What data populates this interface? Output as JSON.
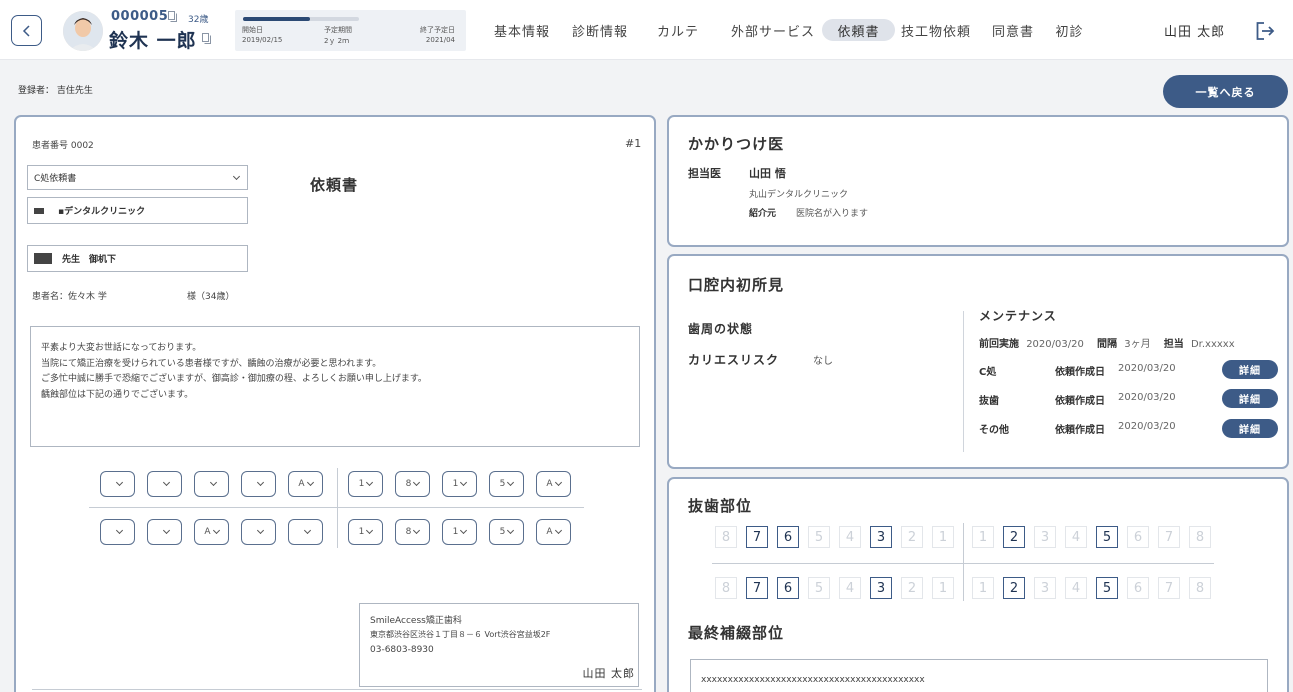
{
  "header": {
    "patient_id": "000005",
    "patient_age": "32歳",
    "patient_name": "鈴木 一郎",
    "period": {
      "start_label": "開始日",
      "start_value": "2019/02/15",
      "duration_label": "予定期間",
      "duration_value": "2ｙ 2ｍ",
      "end_label": "終了予定日",
      "end_value": "2021/04",
      "progress_fraction": 0.58
    },
    "tabs": [
      {
        "label": "基本情報",
        "active": false
      },
      {
        "label": "診断情報",
        "active": false
      },
      {
        "label": "カルテ",
        "active": false
      },
      {
        "label": "外部サービス",
        "active": false
      },
      {
        "label": "依頼書",
        "active": true
      },
      {
        "label": "技工物依頼",
        "active": false
      },
      {
        "label": "同意書",
        "active": false
      },
      {
        "label": "初診",
        "active": false
      }
    ],
    "user_name": "山田 太郎"
  },
  "registrant": "登録者： 吉住先生",
  "back_to_list": "一覧へ戻る",
  "letter": {
    "patient_number": "患者番号 0002",
    "doc_number": "#1",
    "type_select": "C処依頼書",
    "title": "依頼書",
    "clinic_field": "▪デンタルクリニック",
    "doctor_field": "先生　御机下",
    "patient_name_label": "患者名：佐々木 学",
    "patient_honorific": "様（34歳）",
    "body_lines": [
      "平素より大変お世話になっております。",
      "当院にて矯正治療を受けられている患者様ですが、齲蝕の治療が必要と思われます。",
      "ご多忙中誠に勝手で恐縮でございますが、御高診・御加療の程、よろしくお願い申し上げます。",
      "齲蝕部位は下記の通りでございます。"
    ],
    "tooth_selects": {
      "upper_left": [
        "",
        "",
        "",
        "",
        "A"
      ],
      "upper_right": [
        "1",
        "8",
        "1",
        "5",
        "A"
      ],
      "lower_left": [
        "",
        "",
        "A",
        "",
        ""
      ],
      "lower_right": [
        "1",
        "8",
        "1",
        "5",
        "A"
      ]
    },
    "sender": {
      "clinic": "SmileAccess矯正歯科",
      "address": "東京都渋谷区渋谷１丁目８－６ Vort渋谷宮益坂2F",
      "phone": "03-6803-8930",
      "doctor": "山田 太郎"
    }
  },
  "family_doctor": {
    "title": "かかりつけ医",
    "doctor_label": "担当医",
    "doctor_name": "山田 悟",
    "clinic_name": "丸山デンタルクリニック",
    "referrer_label": "紹介元",
    "referrer_value": "医院名が入ります"
  },
  "oral_findings": {
    "title": "口腔内初所見",
    "perio_label": "歯周の状態",
    "caries_label": "カリエスリスク",
    "caries_value": "なし",
    "maintenance_title": "メンテナンス",
    "last_label": "前回実施",
    "last_date": "2020/03/20",
    "interval_label": "間隔",
    "interval_value": "3ヶ月",
    "staff_label": "担当",
    "staff_value": "Dr.xxxxx",
    "requests": [
      {
        "type": "C処",
        "date_label": "依頼作成日",
        "date": "2020/03/20",
        "button": "詳細"
      },
      {
        "type": "抜歯",
        "date_label": "依頼作成日",
        "date": "2020/03/20",
        "button": "詳細"
      },
      {
        "type": "その他",
        "date_label": "依頼作成日",
        "date": "2020/03/20",
        "button": "詳細"
      }
    ]
  },
  "extraction": {
    "title": "抜歯部位",
    "teeth_left": [
      "8",
      "7",
      "6",
      "5",
      "4",
      "3",
      "2",
      "1"
    ],
    "teeth_right": [
      "1",
      "2",
      "3",
      "4",
      "5",
      "6",
      "7",
      "8"
    ],
    "upper_left_selected": [
      "7",
      "6",
      "3"
    ],
    "upper_right_selected": [
      "2",
      "5"
    ],
    "lower_left_selected": [
      "7",
      "6",
      "3"
    ],
    "lower_right_selected": [
      "2",
      "5"
    ]
  },
  "final_restoration": {
    "title": "最終補綴部位",
    "value": "xxxxxxxxxxxxxxxxxxxxxxxxxxxxxxxxxxxxxxxxxx"
  },
  "colors": {
    "primary": "#3d5b87",
    "card_border": "#98a9c2",
    "tab_active_bg": "#dfe3ea"
  }
}
